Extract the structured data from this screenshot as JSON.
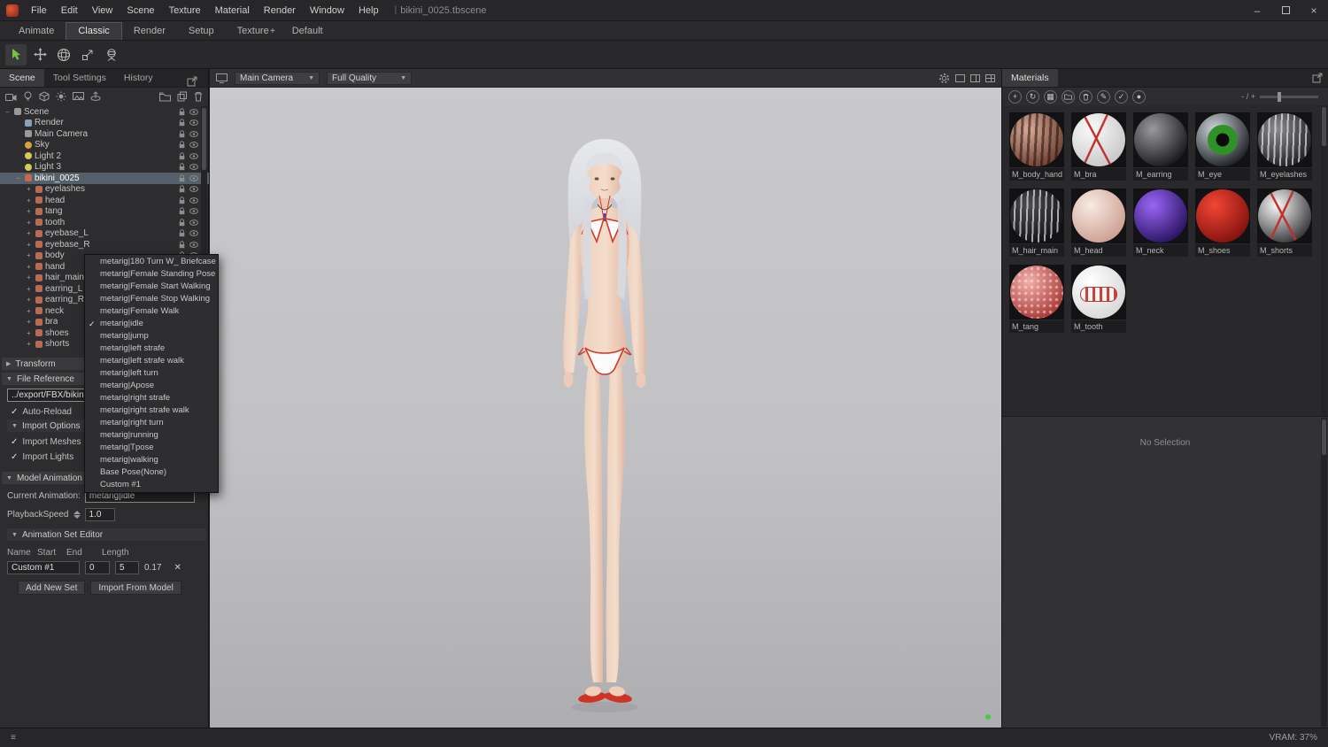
{
  "menubar": {
    "items": [
      "File",
      "Edit",
      "View",
      "Scene",
      "Texture",
      "Material",
      "Render",
      "Window",
      "Help"
    ],
    "separator": "|",
    "document_title": "bikini_0025.tbscene",
    "minimize": "–",
    "close": "×"
  },
  "workspace_tabs": {
    "items": [
      {
        "label": "Animate"
      },
      {
        "label": "Classic",
        "active": true
      },
      {
        "label": "Render"
      },
      {
        "label": "Setup"
      },
      {
        "label": "Texture"
      },
      {
        "label": "Default"
      }
    ],
    "add_tab": "+"
  },
  "left_panel": {
    "tabs": [
      {
        "label": "Scene",
        "active": true
      },
      {
        "label": "Tool Settings"
      },
      {
        "label": "History"
      }
    ],
    "tree": [
      {
        "label": "Scene",
        "depth": 0,
        "icon": "scene",
        "expander": "−"
      },
      {
        "label": "Render",
        "depth": 1,
        "icon": "render",
        "expander": ""
      },
      {
        "label": "Main Camera",
        "depth": 1,
        "icon": "camera",
        "expander": ""
      },
      {
        "label": "Sky",
        "depth": 1,
        "icon": "sky",
        "expander": ""
      },
      {
        "label": "Light 2",
        "depth": 1,
        "icon": "light",
        "expander": ""
      },
      {
        "label": "Light 3",
        "depth": 1,
        "icon": "light",
        "expander": ""
      },
      {
        "label": "bikini_0025",
        "depth": 1,
        "icon": "model",
        "expander": "−",
        "selected": true
      },
      {
        "label": "eyelashes",
        "depth": 2,
        "icon": "mesh",
        "expander": "+"
      },
      {
        "label": "head",
        "depth": 2,
        "icon": "mesh",
        "expander": "+"
      },
      {
        "label": "tang",
        "depth": 2,
        "icon": "mesh",
        "expander": "+"
      },
      {
        "label": "tooth",
        "depth": 2,
        "icon": "mesh",
        "expander": "+"
      },
      {
        "label": "eyebase_L",
        "depth": 2,
        "icon": "mesh",
        "expander": "+"
      },
      {
        "label": "eyebase_R",
        "depth": 2,
        "icon": "mesh",
        "expander": "+"
      },
      {
        "label": "body",
        "depth": 2,
        "icon": "mesh",
        "expander": "+"
      },
      {
        "label": "hand",
        "depth": 2,
        "icon": "mesh",
        "expander": "+"
      },
      {
        "label": "hair_main",
        "depth": 2,
        "icon": "mesh",
        "expander": "+"
      },
      {
        "label": "earring_L",
        "depth": 2,
        "icon": "mesh",
        "expander": "+"
      },
      {
        "label": "earring_R",
        "depth": 2,
        "icon": "mesh",
        "expander": "+"
      },
      {
        "label": "neck",
        "depth": 2,
        "icon": "mesh",
        "expander": "+"
      },
      {
        "label": "bra",
        "depth": 2,
        "icon": "mesh",
        "expander": "+"
      },
      {
        "label": "shoes",
        "depth": 2,
        "icon": "mesh",
        "expander": "+"
      },
      {
        "label": "shorts",
        "depth": 2,
        "icon": "mesh",
        "expander": "+"
      }
    ],
    "transform_header": "Transform",
    "file_reference": {
      "header": "File Reference",
      "path": "../export/FBX/bikini",
      "auto_reload": "Auto-Reload",
      "import_options": "Import Options",
      "import_meshes": "Import Meshes",
      "import_lights": "Import Lights",
      "checkmark": "✓"
    },
    "model_animation": {
      "header": "Model Animation",
      "current_label": "Current Animation:",
      "current_value": "metarig|idle",
      "playback_label": "PlaybackSpeed",
      "playback_value": "1.0",
      "set_editor_header": "Animation Set Editor",
      "columns": [
        "Name",
        "Start",
        "End",
        "Length"
      ],
      "row": {
        "name": "Custom #1",
        "start": "0",
        "end": "5",
        "length": "0.17",
        "delete": "✕"
      },
      "add_button": "Add New Set",
      "import_button": "Import From Model"
    }
  },
  "animation_dropdown": {
    "items": [
      {
        "label": "metarig|180 Turn W_ Briefcase"
      },
      {
        "label": "metarig|Female Standing Pose"
      },
      {
        "label": "metarig|Female Start Walking"
      },
      {
        "label": "metarig|Female Stop Walking"
      },
      {
        "label": "metarig|Female Walk"
      },
      {
        "label": "metarig|idle",
        "checked": true
      },
      {
        "label": "metarig|jump"
      },
      {
        "label": "metarig|left strafe"
      },
      {
        "label": "metarig|left strafe walk"
      },
      {
        "label": "metarig|left turn"
      },
      {
        "label": "metarig|Apose"
      },
      {
        "label": "metarig|right strafe"
      },
      {
        "label": "metarig|right strafe walk"
      },
      {
        "label": "metarig|right turn"
      },
      {
        "label": "metarig|running"
      },
      {
        "label": "metarig|Tpose"
      },
      {
        "label": "metarig|walking"
      },
      {
        "label": "Base Pose(None)"
      },
      {
        "label": "Custom #1"
      }
    ]
  },
  "viewport": {
    "camera_select": "Main Camera",
    "quality_select": "Full Quality"
  },
  "materials_panel": {
    "tab": "Materials",
    "zoom_label": "- / +",
    "items": [
      {
        "name": "M_body_hand",
        "c1": "#d8ab97",
        "c2": "#6e4234",
        "pattern": "streaks-dark"
      },
      {
        "name": "M_bra",
        "c1": "#fafafa",
        "c2": "#c9c9c9",
        "pattern": "redlines"
      },
      {
        "name": "M_earring",
        "c1": "#9a9a9e",
        "c2": "#1a1a1c",
        "pattern": ""
      },
      {
        "name": "M_eye",
        "c1": "#cfd4d8",
        "c2": "#1e2226",
        "pattern": "iris"
      },
      {
        "name": "M_eyelashes",
        "c1": "#8a8a8e",
        "c2": "#222226",
        "pattern": "streaks-light"
      },
      {
        "name": "M_hair_main",
        "c1": "#4c4c50",
        "c2": "#121214",
        "pattern": "streaks-light"
      },
      {
        "name": "M_head",
        "c1": "#f7eae3",
        "c2": "#cda092",
        "pattern": ""
      },
      {
        "name": "M_neck",
        "c1": "#9a66f6",
        "c2": "#2a1462",
        "pattern": ""
      },
      {
        "name": "M_shoes",
        "c1": "#f24634",
        "c2": "#84120e",
        "pattern": ""
      },
      {
        "name": "M_shorts",
        "c1": "#fafafa",
        "c2": "#39393c",
        "pattern": "redlines"
      },
      {
        "name": "M_tang",
        "c1": "#f2aeaa",
        "c2": "#a83a36",
        "pattern": "dots"
      },
      {
        "name": "M_tooth",
        "c1": "#ffffff",
        "c2": "#d8d8d8",
        "pattern": "teeth"
      }
    ],
    "no_selection": "No Selection"
  },
  "status_bar": {
    "left_glyph": "≡",
    "vram": "VRAM: 37%"
  }
}
